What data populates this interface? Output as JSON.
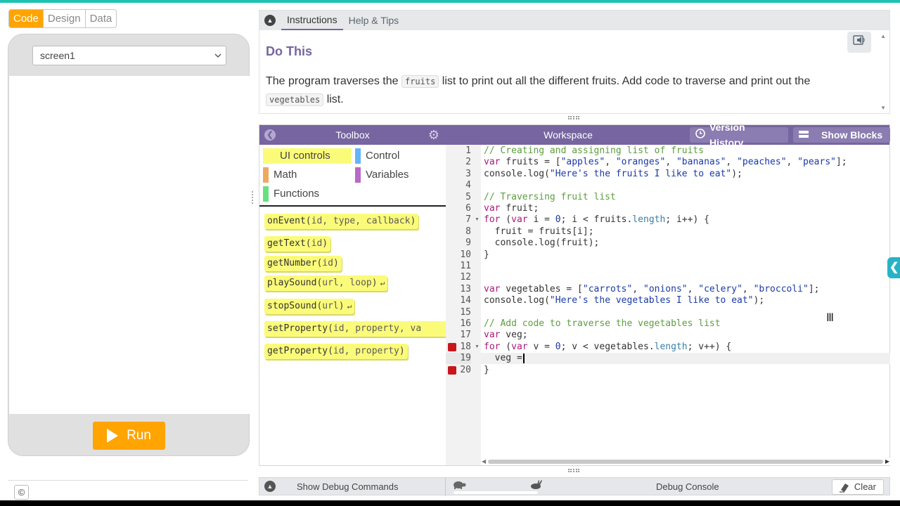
{
  "mode_toggle": {
    "code": "Code",
    "design": "Design",
    "data": "Data",
    "active": "Code"
  },
  "app_preview": {
    "screen_select": "screen1",
    "run_label": "Run",
    "copyright_symbol": "©"
  },
  "instructions": {
    "tabs": [
      {
        "label": "Instructions",
        "active": true
      },
      {
        "label": "Help & Tips",
        "active": false
      }
    ],
    "title": "Do This",
    "body_parts": {
      "before_fruits": "The program traverses the ",
      "fruits_chip": "fruits",
      "middle": " list to print out all the different fruits. Add code to traverse and print out the ",
      "vegetables_chip": "vegetables",
      "after": " list."
    }
  },
  "toolbox": {
    "title": "Toolbox",
    "categories": [
      {
        "label": "UI controls",
        "color": "#fbfb7a",
        "active": true
      },
      {
        "label": "Control",
        "color": "#64b5f6"
      },
      {
        "label": "Math",
        "color": "#f0a860"
      },
      {
        "label": "Variables",
        "color": "#b968c7"
      },
      {
        "label": "Functions",
        "color": "#68e07f"
      }
    ],
    "blocks": [
      {
        "name": "onEvent",
        "params": "id, type, callback",
        "open_paren": "(",
        "close_paren": ")"
      },
      {
        "name": "getText",
        "params": "id",
        "open_paren": "(",
        "close_paren": ")"
      },
      {
        "name": "getNumber",
        "params": "id",
        "open_paren": "(",
        "close_paren": ")"
      },
      {
        "name": "playSound",
        "params": "url, loop",
        "open_paren": "(",
        "close_paren": ")"
      },
      {
        "name": "stopSound",
        "params": "url",
        "open_paren": "(",
        "close_paren": ")"
      },
      {
        "name": "setProperty",
        "params": "id, property, va",
        "open_paren": "(",
        "close_paren": ""
      },
      {
        "name": "getProperty",
        "params": "id, property",
        "open_paren": "(",
        "close_paren": ")"
      }
    ]
  },
  "workspace": {
    "title": "Workspace",
    "version_history": "Version History",
    "show_blocks": "Show Blocks",
    "line_numbers": [
      "1",
      "2",
      "3",
      "4",
      "5",
      "6",
      "7",
      "8",
      "9",
      "10",
      "11",
      "12",
      "13",
      "14",
      "15",
      "16",
      "17",
      "18",
      "19",
      "20"
    ],
    "code": {
      "l1": "// Creating and assigning list of fruits",
      "l2_a": "var",
      "l2_b": " fruits = [",
      "l2_c": "\"apples\"",
      "l2_d": ", ",
      "l2_e": "\"oranges\"",
      "l2_f": ", ",
      "l2_g": "\"bananas\"",
      "l2_h": ", ",
      "l2_i": "\"peaches\"",
      "l2_j": ", ",
      "l2_k": "\"pears\"",
      "l2_l": "];",
      "l3_a": "console.log(",
      "l3_b": "\"Here's the fruits I like to eat\"",
      "l3_c": ");",
      "l5": "// Traversing fruit list",
      "l6_a": "var",
      "l6_b": " fruit;",
      "l7_a": "for",
      "l7_b": " (",
      "l7_c": "var",
      "l7_d": " i = ",
      "l7_e": "0",
      "l7_f": "; i < fruits.",
      "l7_g": "length",
      "l7_h": "; i++) {",
      "l8": "  fruit = fruits[i];",
      "l9": "  console.log(fruit);",
      "l10": "}",
      "l13_a": "var",
      "l13_b": " vegetables = [",
      "l13_c": "\"carrots\"",
      "l13_d": ", ",
      "l13_e": "\"onions\"",
      "l13_f": ", ",
      "l13_g": "\"celery\"",
      "l13_h": ", ",
      "l13_i": "\"broccoli\"",
      "l13_j": "];",
      "l14_a": "console.log(",
      "l14_b": "\"Here's the vegetables I like to eat\"",
      "l14_c": ");",
      "l16": "// Add code to traverse the vegetables list",
      "l17_a": "var",
      "l17_b": " veg;",
      "l18_a": "for",
      "l18_b": " (",
      "l18_c": "var",
      "l18_d": " v = ",
      "l18_e": "0",
      "l18_f": "; v < vegetables.",
      "l18_g": "length",
      "l18_h": "; v++) {",
      "l19": "  veg =",
      "l20": "}"
    },
    "breakpoint_lines": [
      "18",
      "20"
    ],
    "fold_lines": [
      "7",
      "18"
    ]
  },
  "debug": {
    "show_debug_commands": "Show Debug Commands",
    "debug_console": "Debug Console",
    "clear": "Clear"
  },
  "colors": {
    "accent_purple": "#7665a0",
    "run_orange": "#ffa400",
    "top_teal": "#1fc3b4",
    "block_yellow": "#fbfb7a"
  }
}
